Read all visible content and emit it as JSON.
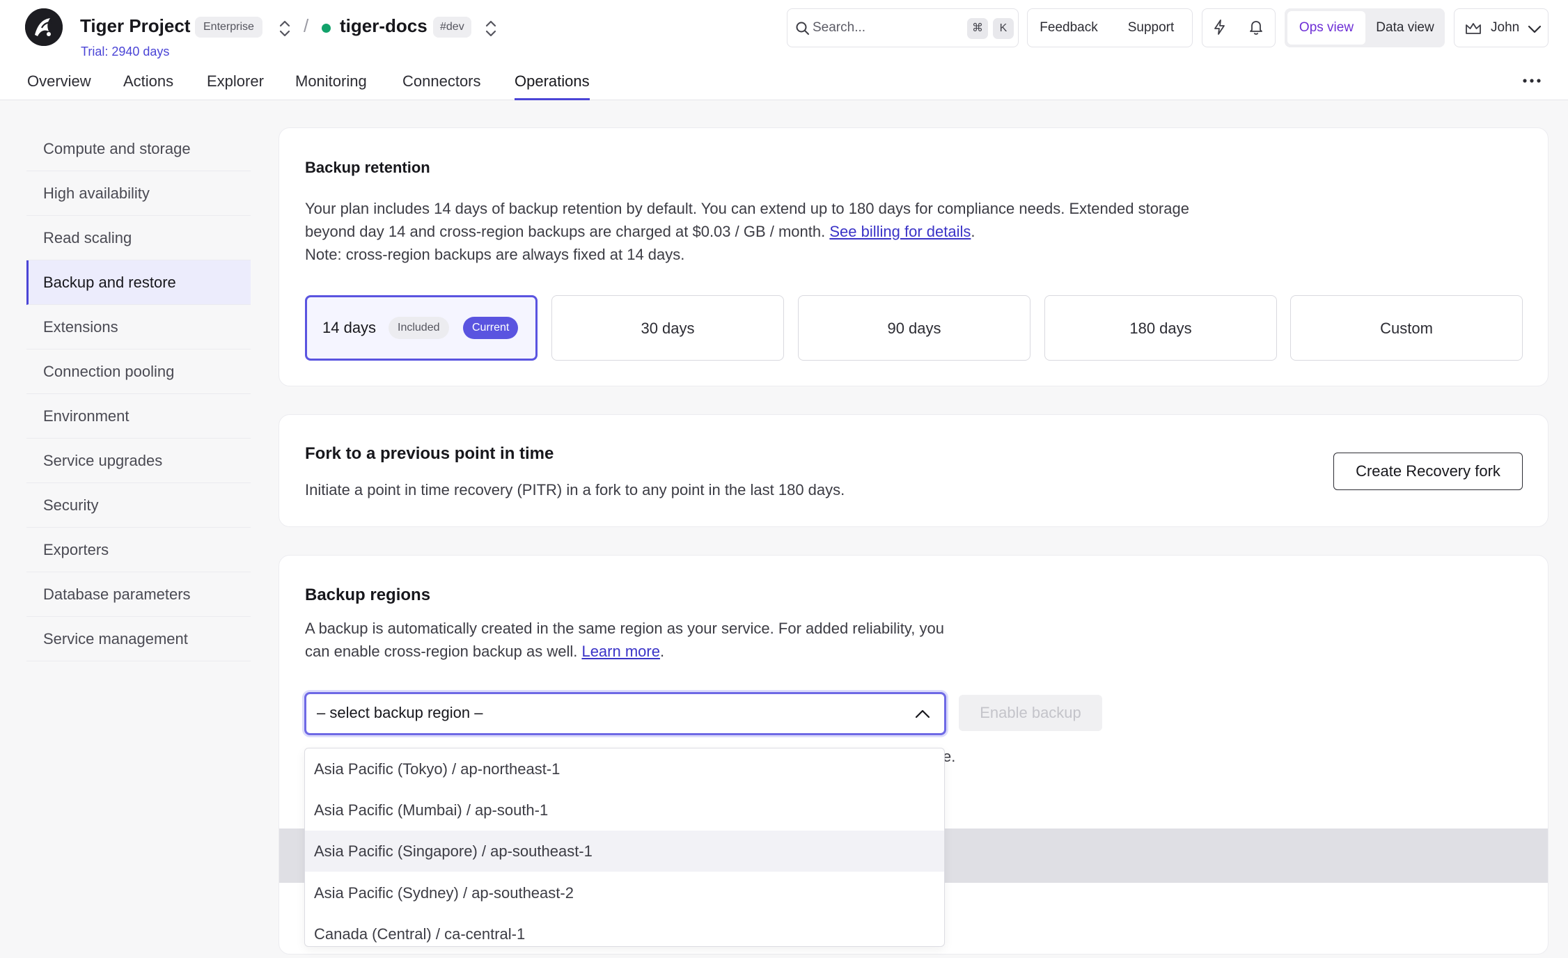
{
  "header": {
    "project_name": "Tiger Project",
    "plan_badge": "Enterprise",
    "trial": "Trial: 2940 days",
    "separator": "/",
    "service_name": "tiger-docs",
    "env_badge": "#dev",
    "search_placeholder": "Search...",
    "shortcut_keys": [
      "⌘",
      "K"
    ],
    "feedback_label": "Feedback",
    "support_label": "Support",
    "view_toggle": {
      "active": "Ops view",
      "other": "Data view"
    },
    "user_name": "John",
    "accent_color": "#4b45d6",
    "icons": [
      "logo-icon",
      "search-icon",
      "bolt-icon",
      "bell-icon",
      "crown-icon",
      "chevron-down-icon",
      "more-icon"
    ]
  },
  "tabs": [
    "Overview",
    "Actions",
    "Explorer",
    "Monitoring",
    "Connectors",
    "Operations"
  ],
  "active_tab": "Operations",
  "sidebar": {
    "items": [
      "Compute and storage",
      "High availability",
      "Read scaling",
      "Backup and restore",
      "Extensions",
      "Connection pooling",
      "Environment",
      "Service upgrades",
      "Security",
      "Exporters",
      "Database parameters",
      "Service management"
    ],
    "active": "Backup and restore"
  },
  "retention": {
    "title": "Backup retention",
    "desc_1": "Your plan includes 14 days of backup retention by default. You can extend up to 180 days for compliance needs. Extended storage",
    "desc_2_prefix": "beyond day 14 and cross-region backups are charged at $0.03 / GB / month. ",
    "desc_2_link": "See billing for details",
    "desc_2_suffix": ".",
    "desc_3": "Note: cross-region backups are always fixed at 14 days.",
    "options": [
      "14 days",
      "30 days",
      "90 days",
      "180 days",
      "Custom"
    ],
    "included_pill": "Included",
    "current_pill": "Current"
  },
  "fork": {
    "title": "Fork to a previous point in time",
    "desc": "Initiate a point in time recovery (PITR) in a fork to any point in the last 180 days.",
    "button": "Create Recovery fork"
  },
  "regions": {
    "title": "Backup regions",
    "desc_1": "A backup is automatically created in the same region as your service. For added reliability, you",
    "desc_2_prefix": "can enable cross-region backup as well. ",
    "desc_2_link": "Learn more",
    "desc_2_suffix": ".",
    "select_value": "– select backup region –",
    "enable_button": "Enable backup",
    "hidden_peek": "e.",
    "dropdown_options": [
      "Asia Pacific (Tokyo) / ap-northeast-1",
      "Asia Pacific (Mumbai) / ap-south-1",
      "Asia Pacific (Singapore) / ap-southeast-1",
      "Asia Pacific (Sydney) / ap-southeast-2",
      "Canada (Central) / ca-central-1"
    ],
    "highlighted_option": "Asia Pacific (Singapore) / ap-southeast-1"
  }
}
